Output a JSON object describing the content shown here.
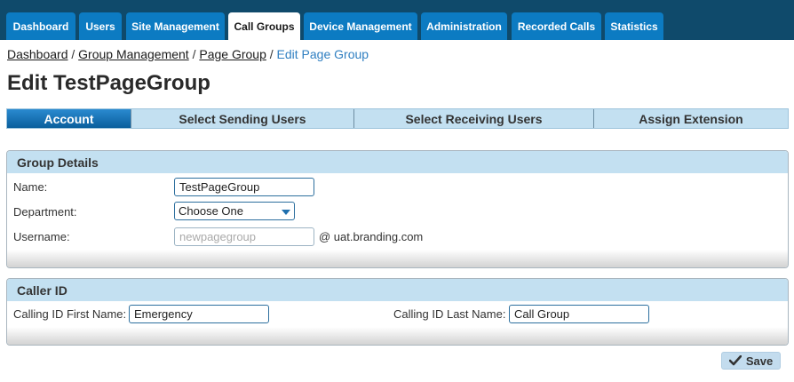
{
  "nav": {
    "tabs": [
      {
        "label": "Dashboard"
      },
      {
        "label": "Users"
      },
      {
        "label": "Site Management"
      },
      {
        "label": "Call Groups"
      },
      {
        "label": "Device Management"
      },
      {
        "label": "Administration"
      },
      {
        "label": "Recorded Calls"
      },
      {
        "label": "Statistics"
      }
    ],
    "active": "Call Groups"
  },
  "breadcrumb": {
    "items": [
      "Dashboard",
      "Group Management",
      "Page Group"
    ],
    "current": "Edit Page Group",
    "separator": " / "
  },
  "page_title": "Edit TestPageGroup",
  "steps": [
    {
      "label": "Account"
    },
    {
      "label": "Select Sending Users"
    },
    {
      "label": "Select Receiving Users"
    },
    {
      "label": "Assign Extension"
    }
  ],
  "group_details": {
    "title": "Group Details",
    "name_label": "Name:",
    "name_value": "TestPageGroup",
    "department_label": "Department:",
    "department_value": "Choose One",
    "username_label": "Username:",
    "username_placeholder": "newpagegroup",
    "domain": "@ uat.branding.com"
  },
  "caller_id": {
    "title": "Caller ID",
    "first_name_label": "Calling ID First Name:",
    "first_name_value": "Emergency",
    "last_name_label": "Calling ID Last Name:",
    "last_name_value": "Call Group"
  },
  "save_label": "Save",
  "colors": {
    "nav_bg": "#0f4a6b",
    "nav_tab": "#0c7bc2",
    "step_active": "#0a5f9c",
    "panel_header": "#c3e0f1",
    "link_current": "#2f7fc1"
  }
}
